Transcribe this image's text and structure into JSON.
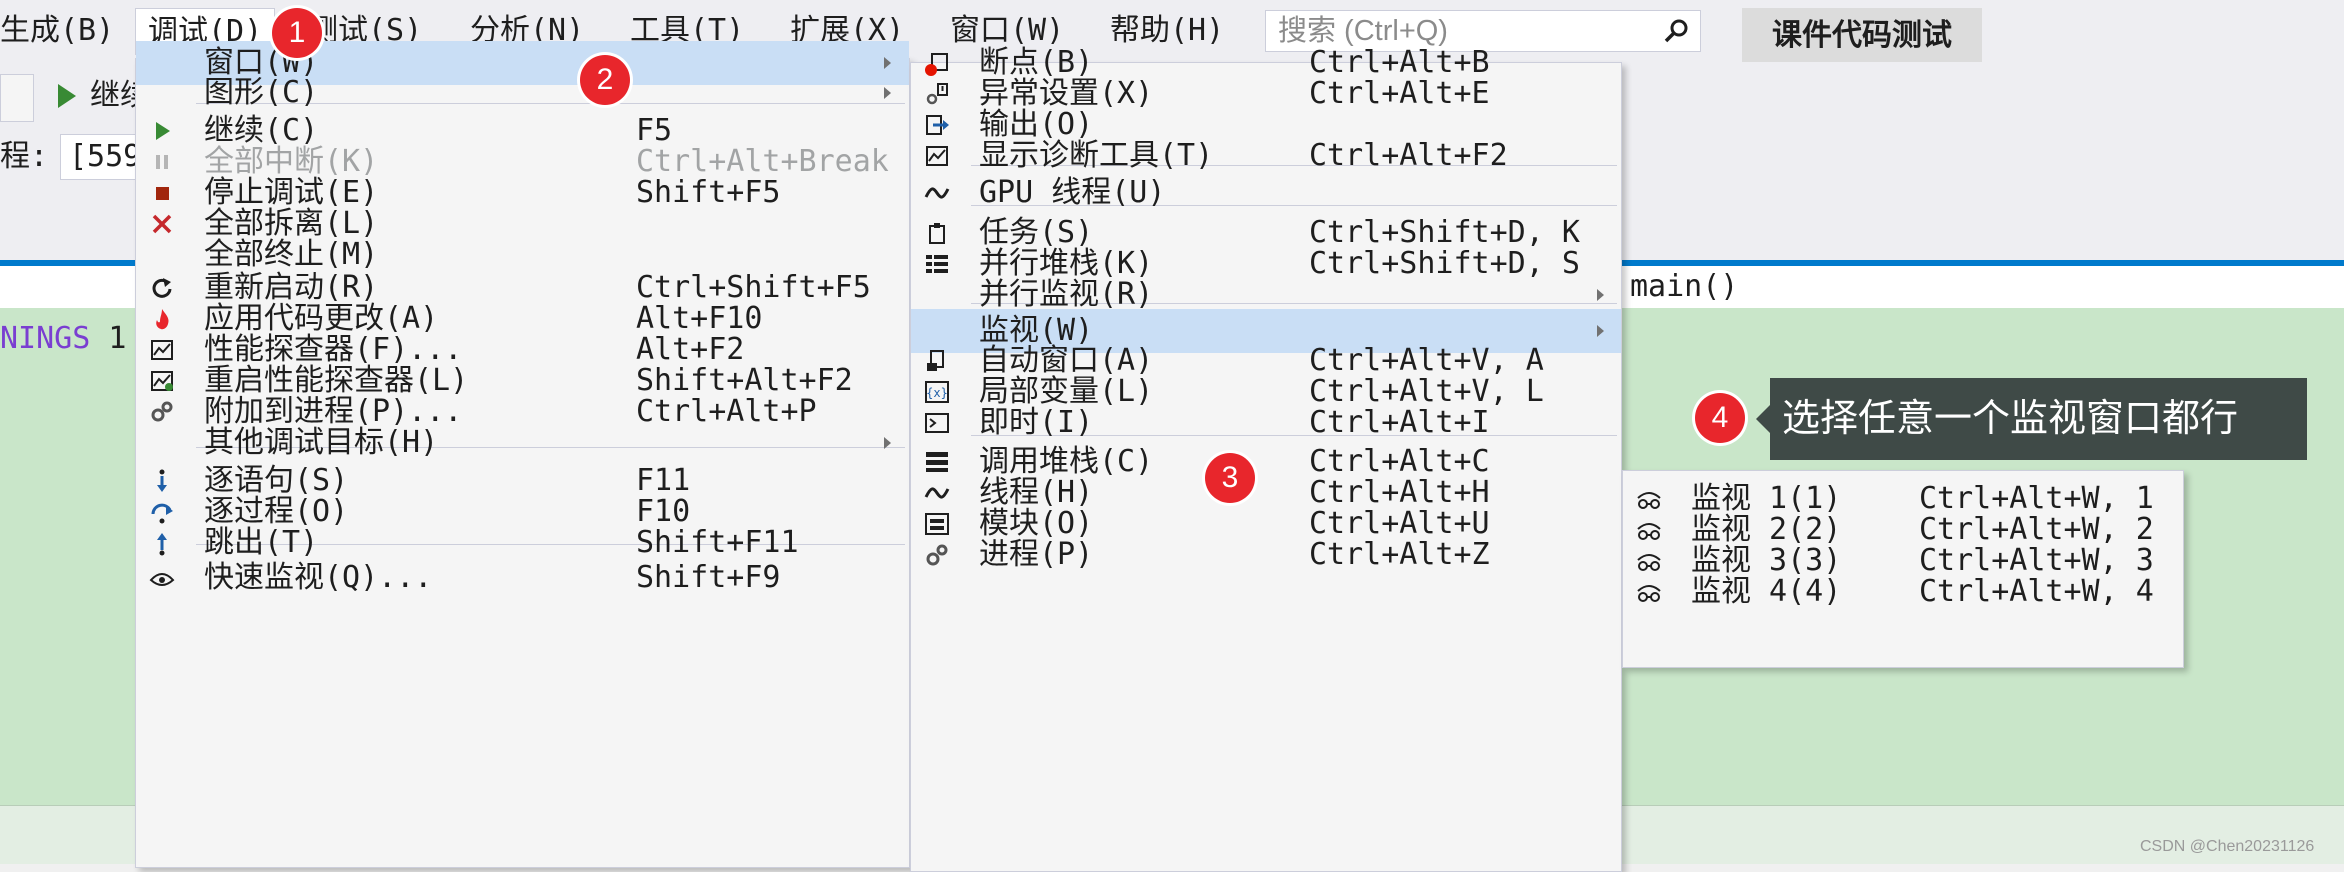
{
  "menubar": {
    "items": [
      "生成(B)",
      "调试(D)",
      "测试(S)",
      "分析(N)",
      "工具(T)",
      "扩展(X)",
      "窗口(W)",
      "帮助(H)"
    ],
    "search_placeholder": "搜索 (Ctrl+Q)",
    "solution_name": "课件代码测试"
  },
  "toolbar": {
    "continue_label": "继续",
    "process_label": "程:",
    "process_value": "[559"
  },
  "editor": {
    "nav_member": "main()",
    "line_text": "NINGS",
    "line_num": "1"
  },
  "debug_menu": {
    "items": [
      {
        "label": "窗口(W)",
        "shortcut": "",
        "icon": "none",
        "submenu": true,
        "highlighted": true
      },
      {
        "label": "图形(C)",
        "shortcut": "",
        "icon": "none",
        "submenu": true
      },
      {
        "label": "继续(C)",
        "shortcut": "F5",
        "icon": "play-icon"
      },
      {
        "label": "全部中断(K)",
        "shortcut": "Ctrl+Alt+Break",
        "icon": "pause-icon",
        "disabled": true
      },
      {
        "label": "停止调试(E)",
        "shortcut": "Shift+F5",
        "icon": "stop-icon"
      },
      {
        "label": "全部拆离(L)",
        "shortcut": "",
        "icon": "detach-icon"
      },
      {
        "label": "全部终止(M)",
        "shortcut": "",
        "icon": "none"
      },
      {
        "label": "重新启动(R)",
        "shortcut": "Ctrl+Shift+F5",
        "icon": "restart-icon"
      },
      {
        "label": "应用代码更改(A)",
        "shortcut": "Alt+F10",
        "icon": "hot-reload-icon"
      },
      {
        "label": "性能探查器(F)...",
        "shortcut": "Alt+F2",
        "icon": "profiler-icon"
      },
      {
        "label": "重启性能探查器(L)",
        "shortcut": "Shift+Alt+F2",
        "icon": "profiler-restart-icon"
      },
      {
        "label": "附加到进程(P)...",
        "shortcut": "Ctrl+Alt+P",
        "icon": "attach-icon"
      },
      {
        "label": "其他调试目标(H)",
        "shortcut": "",
        "icon": "none",
        "submenu": true
      },
      {
        "label": "逐语句(S)",
        "shortcut": "F11",
        "icon": "step-into-icon"
      },
      {
        "label": "逐过程(O)",
        "shortcut": "F10",
        "icon": "step-over-icon"
      },
      {
        "label": "跳出(T)",
        "shortcut": "Shift+F11",
        "icon": "step-out-icon"
      },
      {
        "label": "快速监视(Q)...",
        "shortcut": "Shift+F9",
        "icon": "quickwatch-icon"
      }
    ]
  },
  "windows_menu": {
    "items": [
      {
        "label": "断点(B)",
        "shortcut": "Ctrl+Alt+B",
        "icon": "breakpoint-icon"
      },
      {
        "label": "异常设置(X)",
        "shortcut": "Ctrl+Alt+E",
        "icon": "exception-icon"
      },
      {
        "label": "输出(O)",
        "shortcut": "",
        "icon": "output-icon"
      },
      {
        "label": "显示诊断工具(T)",
        "shortcut": "Ctrl+Alt+F2",
        "icon": "diagnostics-icon"
      },
      {
        "label": "GPU 线程(U)",
        "shortcut": "",
        "icon": "gpu-threads-icon"
      },
      {
        "label": "任务(S)",
        "shortcut": "Ctrl+Shift+D, K",
        "icon": "tasks-icon"
      },
      {
        "label": "并行堆栈(K)",
        "shortcut": "Ctrl+Shift+D, S",
        "icon": "parallel-stacks-icon"
      },
      {
        "label": "并行监视(R)",
        "shortcut": "",
        "icon": "none",
        "submenu": true
      },
      {
        "label": "监视(W)",
        "shortcut": "",
        "icon": "none",
        "submenu": true,
        "highlighted": true
      },
      {
        "label": "自动窗口(A)",
        "shortcut": "Ctrl+Alt+V, A",
        "icon": "autos-icon"
      },
      {
        "label": "局部变量(L)",
        "shortcut": "Ctrl+Alt+V, L",
        "icon": "locals-icon"
      },
      {
        "label": "即时(I)",
        "shortcut": "Ctrl+Alt+I",
        "icon": "immediate-icon"
      },
      {
        "label": "调用堆栈(C)",
        "shortcut": "Ctrl+Alt+C",
        "icon": "call-stack-icon"
      },
      {
        "label": "线程(H)",
        "shortcut": "Ctrl+Alt+H",
        "icon": "threads-icon"
      },
      {
        "label": "模块(O)",
        "shortcut": "Ctrl+Alt+U",
        "icon": "modules-icon"
      },
      {
        "label": "进程(P)",
        "shortcut": "Ctrl+Alt+Z",
        "icon": "processes-icon"
      }
    ]
  },
  "watch_menu": {
    "items": [
      {
        "label": "监视 1(1)",
        "shortcut": "Ctrl+Alt+W, 1",
        "icon": "watch-icon"
      },
      {
        "label": "监视 2(2)",
        "shortcut": "Ctrl+Alt+W, 2",
        "icon": "watch-icon"
      },
      {
        "label": "监视 3(3)",
        "shortcut": "Ctrl+Alt+W, 3",
        "icon": "watch-icon"
      },
      {
        "label": "监视 4(4)",
        "shortcut": "Ctrl+Alt+W, 4",
        "icon": "watch-icon"
      }
    ]
  },
  "annotations": {
    "badges": [
      "1",
      "2",
      "3",
      "4"
    ],
    "callout": "选择任意一个监视窗口都行",
    "watermark": "CSDN @Chen20231126"
  },
  "colors": {
    "accent": "#007acc",
    "highlight": "#c9def5",
    "badge": "#e8262c",
    "editor_bg": "#c9e6c9",
    "callout_bg": "#3f4a47"
  }
}
